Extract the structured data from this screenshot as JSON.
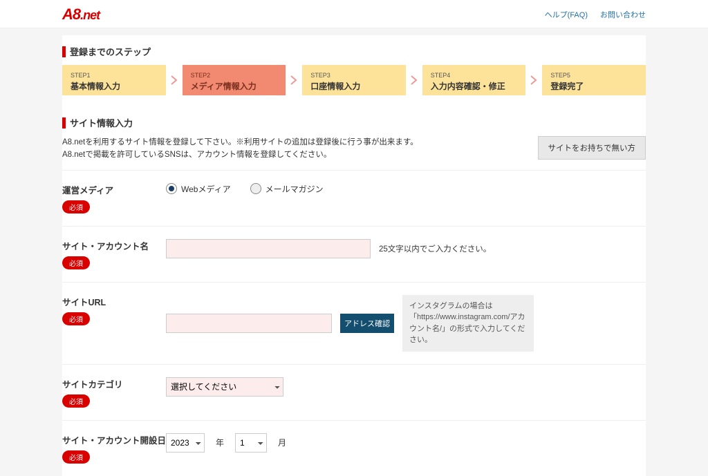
{
  "header": {
    "links": {
      "faq": "ヘルプ(FAQ)",
      "contact": "お問い合わせ"
    }
  },
  "sections": {
    "steps_title": "登録までのステップ",
    "form_title": "サイト情報入力"
  },
  "steps": [
    {
      "num": "STEP1",
      "label": "基本情報入力"
    },
    {
      "num": "STEP2",
      "label": "メディア情報入力"
    },
    {
      "num": "STEP3",
      "label": "口座情報入力"
    },
    {
      "num": "STEP4",
      "label": "入力内容確認・修正"
    },
    {
      "num": "STEP5",
      "label": "登録完了"
    }
  ],
  "description": {
    "line1": "A8.netを利用するサイト情報を登録して下さい。※利用サイトの追加は登録後に行う事が出来ます。",
    "line2": "A8.netで掲載を許可しているSNSは、アカウント情報を登録してください。"
  },
  "buttons": {
    "no_site": "サイトをお持ちで無い方",
    "check_address": "アドレス確認"
  },
  "required_label": "必須",
  "fields": {
    "media": {
      "label": "運営メディア",
      "options": {
        "web": "Webメディア",
        "mail": "メールマガジン"
      },
      "selected": "web"
    },
    "site_name": {
      "label": "サイト・アカウント名",
      "value": "",
      "hint": "25文字以内でご入力ください。"
    },
    "site_url": {
      "label": "サイトURL",
      "value": "",
      "hint": "インスタグラムの場合は「https://www.instagram.com/アカウント名/」の形式で入力してください。"
    },
    "category": {
      "label": "サイトカテゴリ",
      "placeholder": "選択してください"
    },
    "open_date": {
      "label": "サイト・アカウント開設日",
      "year": "2023",
      "year_unit": "年",
      "month": "1",
      "month_unit": "月"
    }
  }
}
